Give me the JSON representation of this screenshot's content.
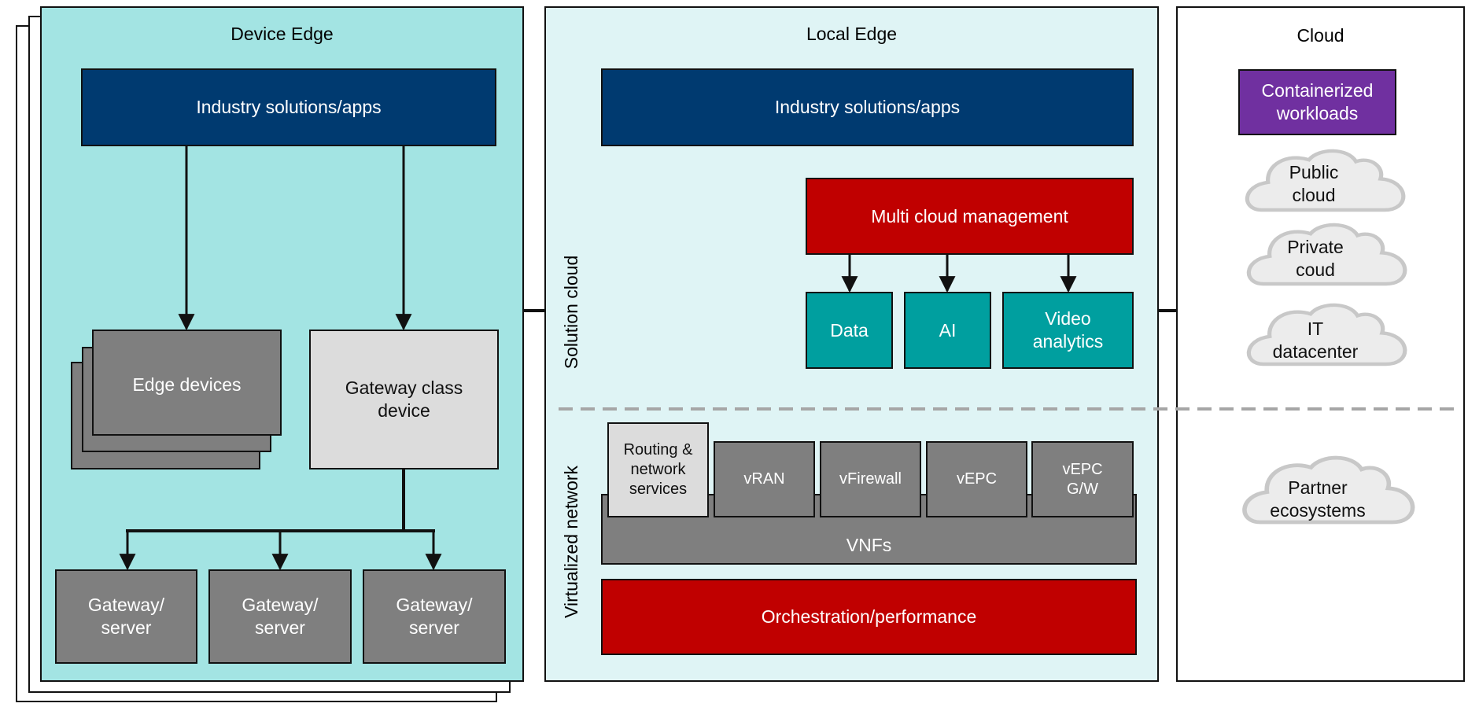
{
  "device_edge": {
    "title": "Device Edge",
    "industry_apps": "Industry solutions/apps",
    "edge_devices": "Edge devices",
    "gateway_class_device": "Gateway class device",
    "gateway_servers": [
      "Gateway/ server",
      "Gateway/ server",
      "Gateway/ server"
    ]
  },
  "local_edge": {
    "title": "Local Edge",
    "industry_apps": "Industry solutions/apps",
    "solution_cloud_label": "Solution cloud",
    "multi_cloud_management": "Multi cloud management",
    "services": [
      "Data",
      "AI",
      "Video analytics"
    ],
    "virtualized_network_label": "Virtualized network",
    "routing": "Routing & network services",
    "vnf_items": [
      "vRAN",
      "vFirewall",
      "vEPC",
      "vEPC G/W"
    ],
    "vnfs": "VNFs",
    "orchestration": "Orchestration/performance"
  },
  "cloud": {
    "title": "Cloud",
    "containerized": "Containerized workloads",
    "clouds": [
      "Public cloud",
      "Private coud",
      "IT datacenter"
    ],
    "partner": "Partner ecosystems"
  },
  "colors": {
    "device_edge_bg": "#a3e4e3",
    "local_edge_bg": "#dff4f5",
    "navy": "#003a70",
    "red": "#c00000",
    "teal": "#009f9f",
    "grey": "#7f7f7f",
    "light_grey": "#dcdcdc",
    "purple": "#7030a0"
  }
}
